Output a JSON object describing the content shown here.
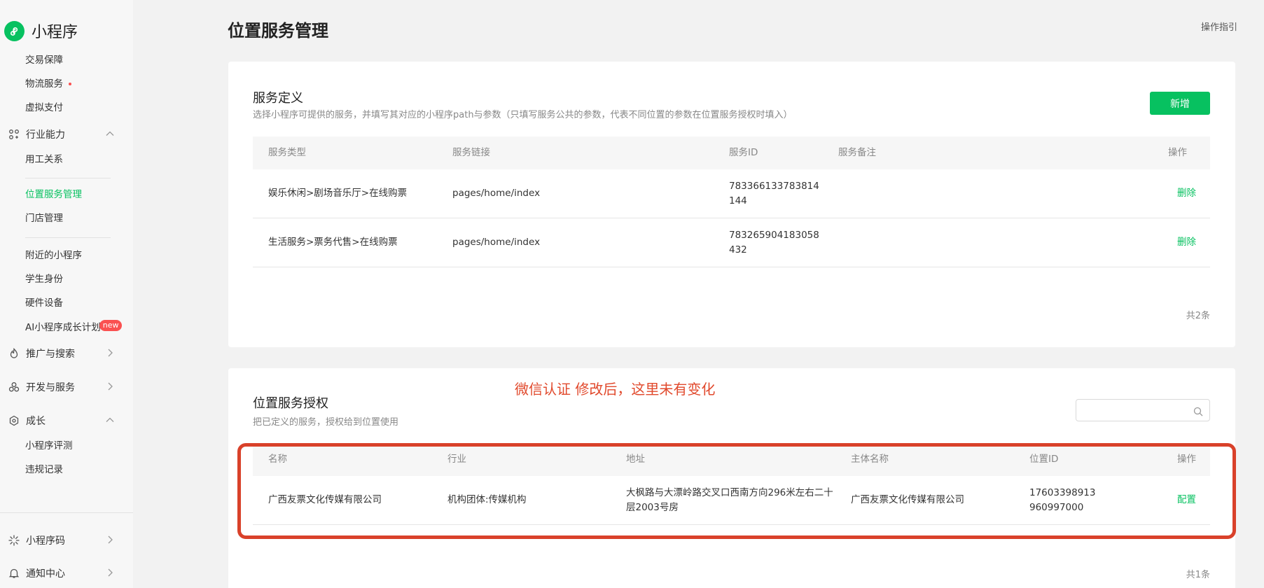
{
  "app": {
    "title": "小程序"
  },
  "sidebar": {
    "items": [
      {
        "label": "交易保障"
      },
      {
        "label": "物流服务"
      },
      {
        "label": "虚拟支付"
      },
      {
        "label": "行业能力"
      },
      {
        "label": "用工关系"
      },
      {
        "label": "位置服务管理"
      },
      {
        "label": "门店管理"
      },
      {
        "label": "附近的小程序"
      },
      {
        "label": "学生身份"
      },
      {
        "label": "硬件设备"
      },
      {
        "label": "AI小程序成长计划",
        "badge": "new"
      },
      {
        "label": "推广与搜索"
      },
      {
        "label": "开发与服务"
      },
      {
        "label": "成长"
      },
      {
        "label": "小程序评测"
      },
      {
        "label": "违规记录"
      },
      {
        "label": "小程序码"
      },
      {
        "label": "通知中心"
      }
    ]
  },
  "header": {
    "title": "位置服务管理",
    "guide": "操作指引"
  },
  "service_definition": {
    "title": "服务定义",
    "desc": "选择小程序可提供的服务，并填写其对应的小程序path与参数（只填写服务公共的参数，代表不同位置的参数在位置服务授权时填入）",
    "add_button": "新增",
    "columns": [
      "服务类型",
      "服务链接",
      "服务ID",
      "服务备注",
      "操作"
    ],
    "rows": [
      {
        "type": "娱乐休闲>剧场音乐厅>在线购票",
        "link": "pages/home/index",
        "id_l1": "783366133783814",
        "id_l2": "144",
        "note": "",
        "op": "删除"
      },
      {
        "type": "生活服务>票务代售>在线购票",
        "link": "pages/home/index",
        "id_l1": "783265904183058",
        "id_l2": "432",
        "note": "",
        "op": "删除"
      }
    ],
    "total": "共2条"
  },
  "location_auth": {
    "title": "位置服务授权",
    "desc": "把已定义的服务，授权给到位置使用",
    "search": {
      "placeholder": "",
      "value": ""
    },
    "columns": [
      "名称",
      "行业",
      "地址",
      "主体名称",
      "位置ID",
      "操作"
    ],
    "rows": [
      {
        "name": "广西友票文化传媒有限公司",
        "industry": "机构团体:传媒机构",
        "addr_l1": "大枫路与大漂岭路交叉口西南方向296米左右二十",
        "addr_l2": "层2003号房",
        "entity": "广西友票文化传媒有限公司",
        "loc_l1": "17603398913",
        "loc_l2": "960997000",
        "op": "配置"
      }
    ],
    "total": "共1条"
  },
  "annotation": {
    "text": "微信认证 修改后，这里未有变化"
  },
  "colors": {
    "accent": "#07c160",
    "annotation": "#d9412a",
    "badge": "#fa5151"
  },
  "icons": [
    "miniprogram-logo-icon",
    "industry-icon",
    "promote-icon",
    "dev-service-icon",
    "growth-icon",
    "qrcode-icon",
    "bell-icon",
    "search-icon",
    "chevron-up-icon",
    "chevron-right-icon"
  ]
}
